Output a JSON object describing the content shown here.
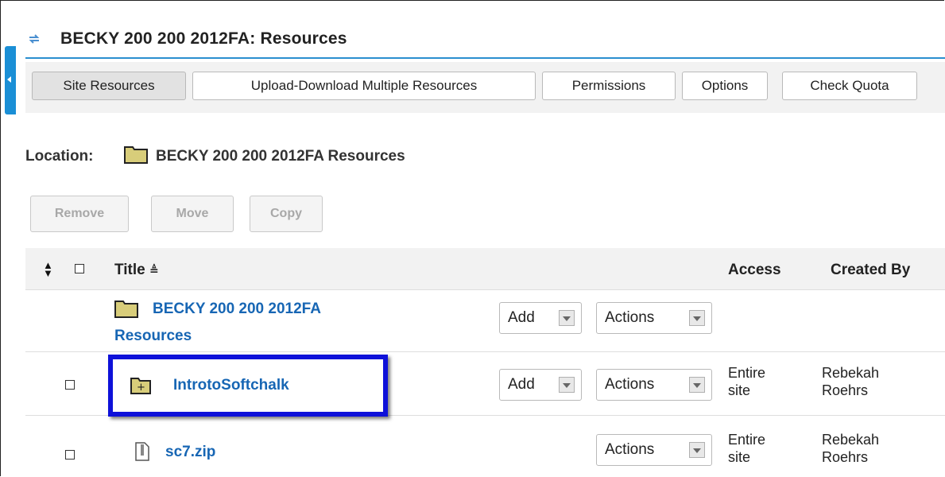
{
  "header": {
    "title": "BECKY 200 200 2012FA: Resources",
    "icon": "sync-icon"
  },
  "toolbar": {
    "site_resources": "Site Resources",
    "upload_download": "Upload-Download Multiple Resources",
    "permissions": "Permissions",
    "options": "Options",
    "check_quota": "Check Quota"
  },
  "location": {
    "label": "Location:",
    "path": "BECKY 200 200 2012FA Resources"
  },
  "actions": {
    "remove": "Remove",
    "move": "Move",
    "copy": "Copy"
  },
  "table": {
    "headers": {
      "title": "Title",
      "access": "Access",
      "created_by": "Created By"
    },
    "rows": [
      {
        "title_line1": "BECKY 200 200 2012FA",
        "title_line2": "Resources",
        "add": "Add",
        "actions": "Actions",
        "access": "",
        "created_by": ""
      },
      {
        "title": "IntrotoSoftchalk",
        "add": "Add",
        "actions": "Actions",
        "access_line1": "Entire",
        "access_line2": "site",
        "created_line1": "Rebekah",
        "created_line2": "Roehrs"
      },
      {
        "title": "sc7.zip",
        "actions": "Actions",
        "access_line1": "Entire",
        "access_line2": "site",
        "created_line1": "Rebekah",
        "created_line2": "Roehrs"
      }
    ]
  },
  "colors": {
    "link": "#1766b4",
    "accent": "#2a8fcf",
    "highlight": "#0e11d9",
    "folder": "#d8cd7a"
  }
}
